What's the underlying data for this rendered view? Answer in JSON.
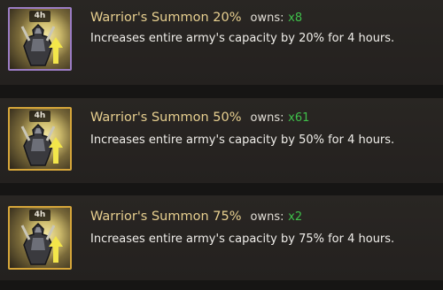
{
  "items": [
    {
      "badge": "4h",
      "title": "Warrior's Summon 20%",
      "owns_label": "owns:",
      "count": "x8",
      "description": "Increases entire army's capacity by 20% for 4 hours.",
      "frame_color": "#9b7cc4"
    },
    {
      "badge": "4h",
      "title": "Warrior's Summon 50%",
      "owns_label": "owns:",
      "count": "x61",
      "description": "Increases entire army's capacity by 50% for 4 hours.",
      "frame_color": "#d6a63a"
    },
    {
      "badge": "4h",
      "title": "Warrior's Summon 75%",
      "owns_label": "owns:",
      "count": "x2",
      "description": "Increases entire army's capacity by 75% for 4 hours.",
      "frame_color": "#d6a63a"
    }
  ],
  "icons": {
    "item_icon": "warrior-summon-icon",
    "boost_icon": "arrow-up-icon"
  },
  "colors": {
    "title": "#e7cf8f",
    "count": "#3fbf4a",
    "description": "#f0eeea",
    "background": "#24211f"
  }
}
